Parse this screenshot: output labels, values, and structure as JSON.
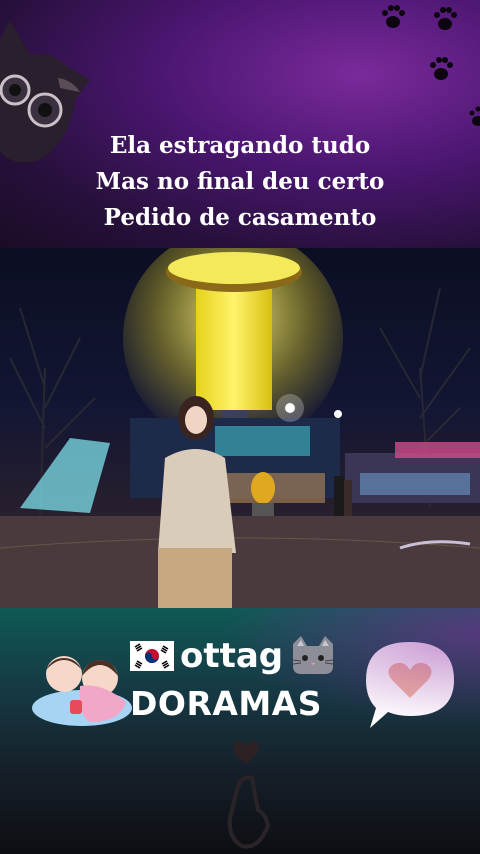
{
  "caption": {
    "line1": "Ela estragando tudo",
    "line2": "Mas no final deu certo",
    "line3": "Pedido de casamento"
  },
  "brand": {
    "name": "ottag",
    "subtitle": "DORAMAS"
  },
  "icons": {
    "flag": "south-korea-flag-icon",
    "cat": "cat-face-icon",
    "couple": "couple-sticker-icon",
    "speech_heart": "heart-speech-bubble-icon",
    "finger_heart": "finger-heart-icon",
    "paws": "paw-print-icon"
  },
  "colors": {
    "top_bg": "#4a1670",
    "bottom_bg": "#0f5a55",
    "tower_light": "#f4ea3a",
    "caption_text": "#ffffff"
  }
}
